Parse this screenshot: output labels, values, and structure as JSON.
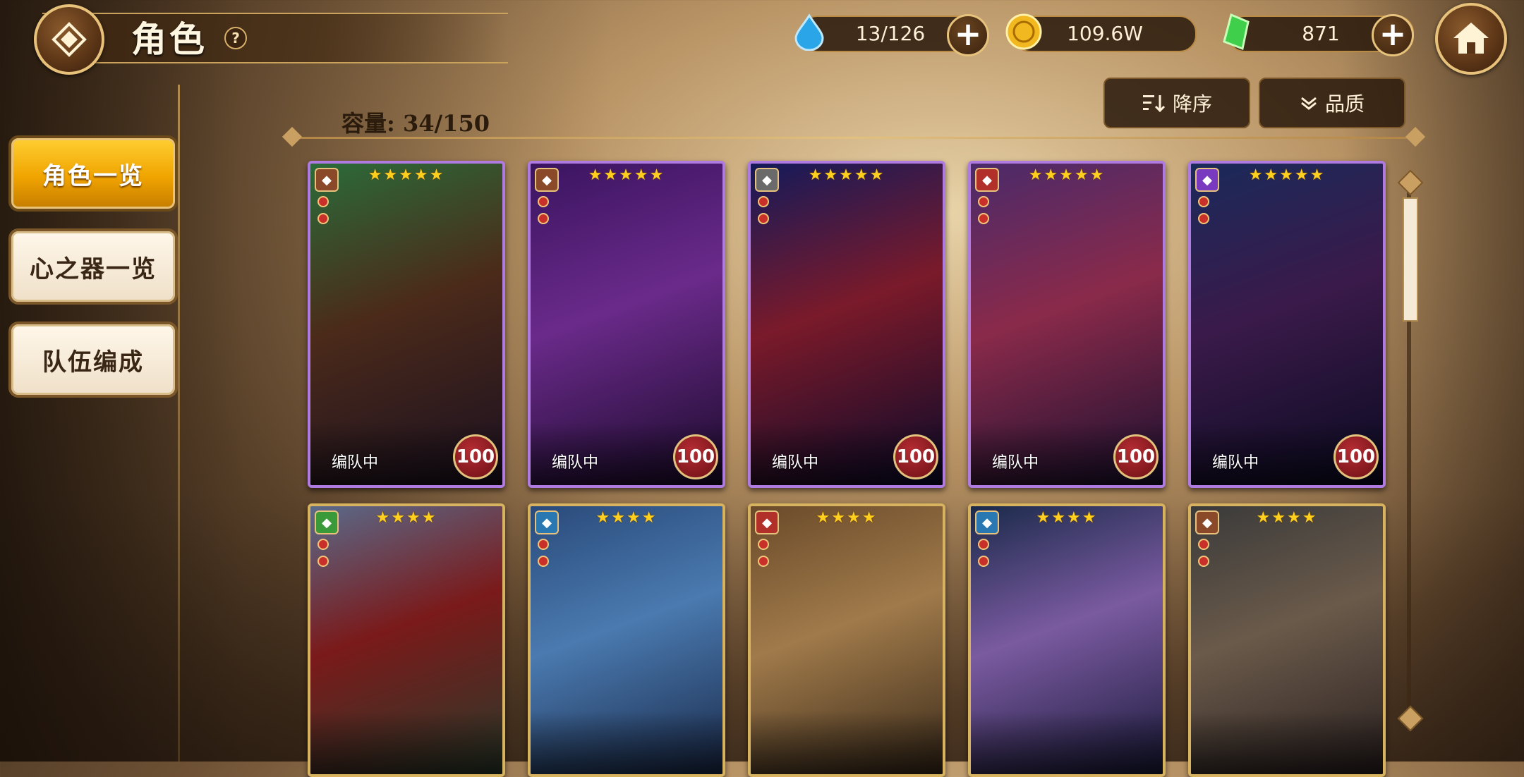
{
  "header": {
    "title": "角色",
    "help": "?"
  },
  "resources": [
    {
      "name": "stamina",
      "value": "13/126",
      "icon": "water-drop-icon",
      "has_plus": true
    },
    {
      "name": "gold",
      "value": "109.6W",
      "icon": "gold-coin-icon",
      "has_plus": false
    },
    {
      "name": "gem",
      "value": "871",
      "icon": "green-crystal-icon",
      "has_plus": true
    }
  ],
  "sidebar": {
    "items": [
      {
        "label": "角色一览",
        "active": true
      },
      {
        "label": "心之器一览",
        "active": false
      },
      {
        "label": "队伍编成",
        "active": false
      }
    ]
  },
  "list": {
    "capacity": "容量: 34/150",
    "sort_label": "降序",
    "filter_label": "品质"
  },
  "colors": {
    "accent": "#f0a400",
    "gold_border": "#d7b25f",
    "level_red": "#b52d33"
  },
  "cards": [
    {
      "stars": "★★★★★",
      "team": "编队中",
      "level": "100",
      "element": "wind",
      "element_color": "#8a4a2a",
      "frame": "#b07be0"
    },
    {
      "stars": "★★★★★",
      "team": "编队中",
      "level": "100",
      "element": "wind",
      "element_color": "#8a4a2a",
      "frame": "#b07be0"
    },
    {
      "stars": "★★★★★",
      "team": "编队中",
      "level": "100",
      "element": "neutral",
      "element_color": "#6a6a6a",
      "frame": "#b07be0"
    },
    {
      "stars": "★★★★★",
      "team": "编队中",
      "level": "100",
      "element": "fire",
      "element_color": "#b2302a",
      "frame": "#b07be0"
    },
    {
      "stars": "★★★★★",
      "team": "编队中",
      "level": "100",
      "element": "dark",
      "element_color": "#7a3ac0",
      "frame": "#b07be0"
    },
    {
      "stars": "★★★★",
      "team": "",
      "level": "",
      "element": "nature",
      "element_color": "#3a9a3a",
      "frame": "#d7b25f"
    },
    {
      "stars": "★★★★",
      "team": "",
      "level": "",
      "element": "water",
      "element_color": "#2a78b2",
      "frame": "#d7b25f"
    },
    {
      "stars": "★★★★",
      "team": "",
      "level": "",
      "element": "fire",
      "element_color": "#b2302a",
      "frame": "#d7b25f"
    },
    {
      "stars": "★★★★",
      "team": "",
      "level": "",
      "element": "water",
      "element_color": "#2a78b2",
      "frame": "#d7b25f"
    },
    {
      "stars": "★★★★",
      "team": "",
      "level": "",
      "element": "wind",
      "element_color": "#8a4a2a",
      "frame": "#d7b25f"
    }
  ]
}
